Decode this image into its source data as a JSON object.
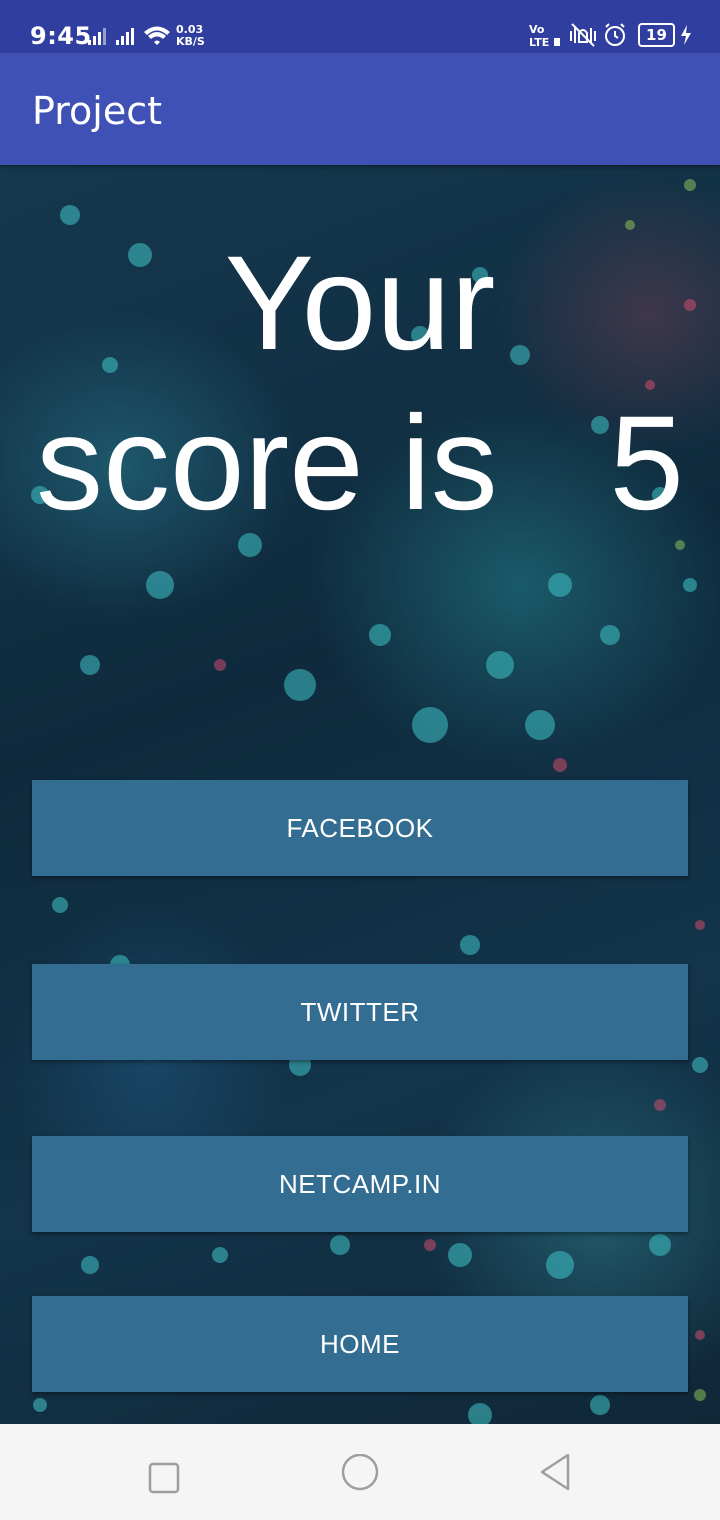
{
  "status_bar": {
    "time": "9:45",
    "speed_value": "0.03",
    "speed_unit": "KB/S",
    "battery": "19"
  },
  "app_bar": {
    "title": "Project"
  },
  "score": {
    "line1": "Your",
    "line2": "score is   5"
  },
  "buttons": {
    "facebook": "FACEBOOK",
    "twitter": "TWITTER",
    "netcamp": "NETCAMP.IN",
    "home": "HOME"
  },
  "nav": {
    "recents_icon": "square-icon",
    "home_icon": "circle-icon",
    "back_icon": "triangle-back-icon"
  },
  "colors": {
    "status_bar": "#303f9f",
    "app_bar": "#3f51b5",
    "button": "#336d91",
    "nav_bar": "#f5f5f5"
  }
}
